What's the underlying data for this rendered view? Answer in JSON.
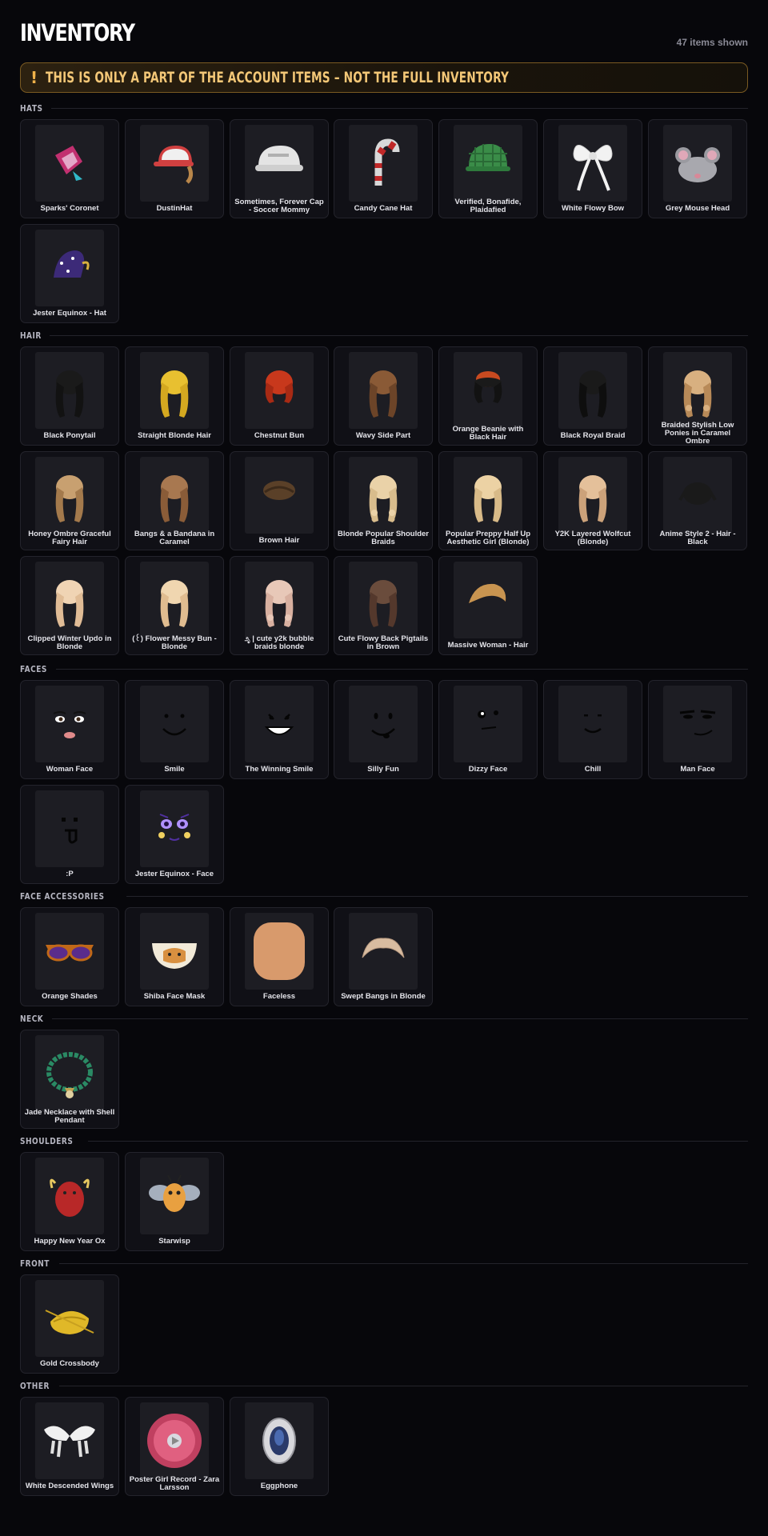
{
  "header": {
    "title": "INVENTORY",
    "count": "47 items shown"
  },
  "banner": {
    "icon": "!",
    "text": "THIS IS ONLY A PART OF THE ACCOUNT ITEMS – NOT THE FULL INVENTORY",
    "color": "#f3c777"
  },
  "sections": [
    {
      "label": "HATS",
      "items": [
        {
          "name": "Sparks' Coronet",
          "icon": "coronet-icon"
        },
        {
          "name": "DustinHat",
          "icon": "trucker-cap-icon"
        },
        {
          "name": "Sometimes, Forever Cap - Soccer Mommy",
          "icon": "white-cap-icon"
        },
        {
          "name": "Candy Cane Hat",
          "icon": "candy-cane-icon"
        },
        {
          "name": "Verified, Bonafide, Plaidafied",
          "icon": "plaid-cap-icon"
        },
        {
          "name": "White Flowy Bow",
          "icon": "bow-icon"
        },
        {
          "name": "Grey Mouse Head",
          "icon": "mouse-head-icon"
        },
        {
          "name": "Jester Equinox - Hat",
          "icon": "jester-hat-icon"
        }
      ]
    },
    {
      "label": "HAIR",
      "items": [
        {
          "name": "Black Ponytail",
          "icon": "hair-icon"
        },
        {
          "name": "Straight Blonde Hair",
          "icon": "hair-icon"
        },
        {
          "name": "Chestnut Bun",
          "icon": "hair-icon"
        },
        {
          "name": "Wavy Side Part",
          "icon": "hair-icon"
        },
        {
          "name": "Orange Beanie with Black Hair",
          "icon": "hair-icon"
        },
        {
          "name": "Black Royal Braid",
          "icon": "hair-icon"
        },
        {
          "name": "Braided Stylish Low Ponies in Caramel Ombre",
          "icon": "hair-icon"
        },
        {
          "name": "Honey Ombre Graceful Fairy Hair",
          "icon": "hair-icon"
        },
        {
          "name": "Bangs & a Bandana in Caramel",
          "icon": "hair-icon"
        },
        {
          "name": "Brown Hair",
          "icon": "hair-icon"
        },
        {
          "name": "Blonde Popular Shoulder Braids",
          "icon": "hair-icon"
        },
        {
          "name": "Popular Preppy Half Up Aesthetic Girl (Blonde)",
          "icon": "hair-icon"
        },
        {
          "name": "Y2K Layered Wolfcut (Blonde)",
          "icon": "hair-icon"
        },
        {
          "name": "Anime Style 2 - Hair - Black",
          "icon": "hair-icon"
        },
        {
          "name": "Clipped Winter Updo in Blonde",
          "icon": "hair-icon"
        },
        {
          "name": "(꒰) Flower Messy Bun - Blonde",
          "icon": "hair-icon"
        },
        {
          "name": "೨ೃ | cute y2k bubble braids blonde",
          "icon": "hair-icon"
        },
        {
          "name": "Cute Flowy Back Pigtails in Brown",
          "icon": "hair-icon"
        },
        {
          "name": "Massive Woman - Hair",
          "icon": "hair-icon"
        }
      ]
    },
    {
      "label": "FACES",
      "items": [
        {
          "name": "Woman Face",
          "icon": "face-icon"
        },
        {
          "name": "Smile",
          "icon": "face-icon"
        },
        {
          "name": "The Winning Smile",
          "icon": "face-icon"
        },
        {
          "name": "Silly Fun",
          "icon": "face-icon"
        },
        {
          "name": "Dizzy Face",
          "icon": "face-icon"
        },
        {
          "name": "Chill",
          "icon": "face-icon"
        },
        {
          "name": "Man Face",
          "icon": "face-icon"
        },
        {
          "name": ":P",
          "icon": "face-icon"
        },
        {
          "name": "Jester Equinox - Face",
          "icon": "face-icon"
        }
      ]
    },
    {
      "label": "FACE ACCESSORIES",
      "items": [
        {
          "name": "Orange Shades",
          "icon": "sunglasses-icon"
        },
        {
          "name": "Shiba Face Mask",
          "icon": "shiba-mask-icon"
        },
        {
          "name": "Faceless",
          "icon": "blank-head-icon"
        },
        {
          "name": "Swept Bangs in Blonde",
          "icon": "bangs-icon"
        }
      ]
    },
    {
      "label": "NECK",
      "items": [
        {
          "name": "Jade Necklace with Shell Pendant",
          "icon": "necklace-icon"
        }
      ]
    },
    {
      "label": "SHOULDERS",
      "items": [
        {
          "name": "Happy New Year Ox",
          "icon": "ox-icon"
        },
        {
          "name": "Starwisp",
          "icon": "starwisp-icon"
        }
      ]
    },
    {
      "label": "FRONT",
      "items": [
        {
          "name": "Gold Crossbody",
          "icon": "bag-icon"
        }
      ]
    },
    {
      "label": "OTHER",
      "items": [
        {
          "name": "White Descended Wings",
          "icon": "wings-icon"
        },
        {
          "name": "Poster Girl Record - Zara Larsson",
          "icon": "record-icon"
        },
        {
          "name": "Eggphone",
          "icon": "eggphone-icon"
        }
      ]
    }
  ]
}
